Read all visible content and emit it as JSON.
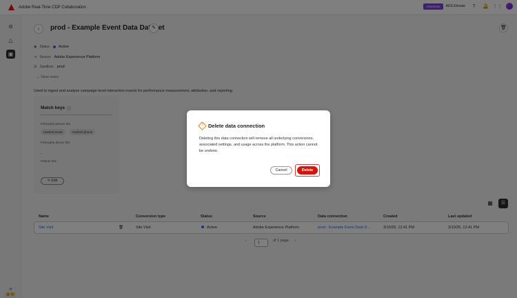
{
  "app": {
    "title": "Adobe Real-Time CDP Collaboration",
    "badge": "Advertiser",
    "org": "ADS Elevate"
  },
  "page": {
    "title": "prod - Example Event Data Dataset",
    "status_label": "Status:",
    "status_value": "Active",
    "source_label": "Source:",
    "source_value": "Adobe Experience Platform",
    "sandbox_label": "Sandbox:",
    "sandbox_value": "prod",
    "view_more": "View more",
    "description": "Used to ingest and analyze campaign-level interaction events for performance measurement, attribution, and reporting."
  },
  "match_keys": {
    "title": "Match keys",
    "person_label": "First-party person IDs",
    "person_chips": [
      "Hashed email",
      "Hashed phone"
    ],
    "device_label": "First-party device IDs",
    "device_value": "-",
    "partner_label": "Partner IDs",
    "edit_label": "Edit"
  },
  "table": {
    "headers": [
      "Name",
      "Conversion type",
      "Status",
      "Source",
      "Data connection",
      "Created",
      "Last updated"
    ],
    "row": {
      "name": "Site Visit",
      "type": "Site Visit",
      "status": "Active",
      "source": "Adobe Experience Platform",
      "connection": "prod - Example Event Data D...",
      "created": "3/10/26, 12:41 PM",
      "updated": "3/10/26, 12:41 PM"
    }
  },
  "pagination": {
    "page": "1",
    "of_pages": "of 1 page"
  },
  "dialog": {
    "title": "Delete data connection",
    "body": "Deleting this data connection will remove all underlying conversions, associated settings, and usage across the platform. This action cannot be undone.",
    "cancel_label": "Cancel",
    "delete_label": "Delete"
  },
  "colors": {
    "accent_delete": "#d31510",
    "badge": "#7e3af2",
    "link": "#2d6be4",
    "warning": "#e68619"
  }
}
